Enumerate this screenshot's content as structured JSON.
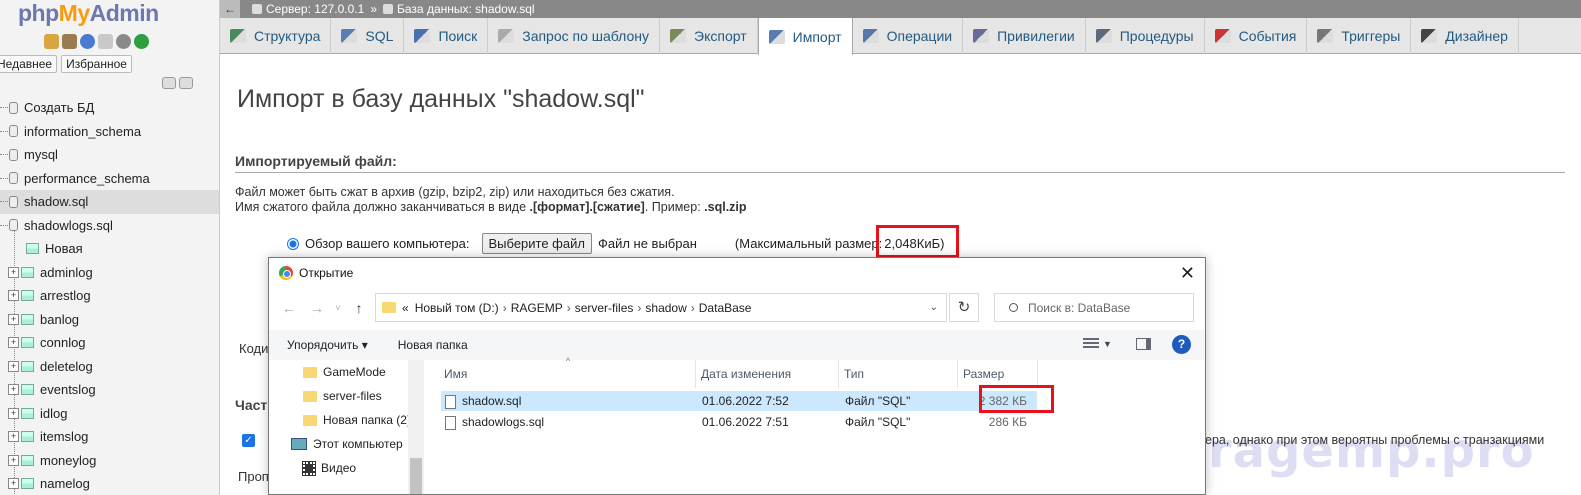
{
  "nav": {
    "logo_php": "php",
    "logo_my": "My",
    "logo_admin": "Admin",
    "recent_tab": "Недавнее",
    "favorites_tab": "Избранное",
    "tree": [
      {
        "label": "Создать БД",
        "kind": "root"
      },
      {
        "label": "information_schema",
        "kind": "db"
      },
      {
        "label": "mysql",
        "kind": "db"
      },
      {
        "label": "performance_schema",
        "kind": "db"
      },
      {
        "label": "shadow.sql",
        "kind": "db",
        "active": true
      },
      {
        "label": "shadowlogs.sql",
        "kind": "db"
      },
      {
        "label": "Новая",
        "kind": "new"
      },
      {
        "label": "adminlog",
        "kind": "table"
      },
      {
        "label": "arrestlog",
        "kind": "table"
      },
      {
        "label": "banlog",
        "kind": "table"
      },
      {
        "label": "connlog",
        "kind": "table"
      },
      {
        "label": "deletelog",
        "kind": "table"
      },
      {
        "label": "eventslog",
        "kind": "table"
      },
      {
        "label": "idlog",
        "kind": "table"
      },
      {
        "label": "itemslog",
        "kind": "table"
      },
      {
        "label": "moneylog",
        "kind": "table"
      },
      {
        "label": "namelog",
        "kind": "table"
      }
    ]
  },
  "breadcrumb": {
    "server": "Сервер: 127.0.0.1",
    "sep": "»",
    "database": "База данных: shadow.sql"
  },
  "tabs": [
    {
      "label": "Структура",
      "icon": "structure-icon"
    },
    {
      "label": "SQL",
      "icon": "sql-icon"
    },
    {
      "label": "Поиск",
      "icon": "search-icon"
    },
    {
      "label": "Запрос по шаблону",
      "icon": "query-icon"
    },
    {
      "label": "Экспорт",
      "icon": "export-icon"
    },
    {
      "label": "Импорт",
      "icon": "import-icon",
      "active": true
    },
    {
      "label": "Операции",
      "icon": "operations-icon"
    },
    {
      "label": "Привилегии",
      "icon": "privileges-icon"
    },
    {
      "label": "Процедуры",
      "icon": "routines-icon"
    },
    {
      "label": "События",
      "icon": "events-icon"
    },
    {
      "label": "Триггеры",
      "icon": "triggers-icon"
    },
    {
      "label": "Дизайнер",
      "icon": "designer-icon"
    }
  ],
  "main": {
    "title": "Импорт в базу данных \"shadow.sql\"",
    "section_title": "Импортируемый файл:",
    "desc_line1": "Файл может быть сжат в архив (gzip, bzip2, zip) или находиться без сжатия.",
    "desc_line2_pre": "Имя сжатого файла должно заканчиваться в виде ",
    "desc_line2_bold": ".[формат].[сжатие]",
    "desc_line2_mid": ". Пример: ",
    "desc_line2_example": ".sql.zip",
    "browse_label": "Обзор вашего компьютера:",
    "choose_file": "Выберите файл",
    "no_file": "Файл не выбран",
    "max_size_label": "(Максимальный размер:",
    "max_size_value": "2,048КиБ)",
    "cut_kodi": "Коди",
    "cut_chast": "Част",
    "cut_prop": "Проп",
    "right_text": "ера, однако при этом вероятны проблемы с транзакциями",
    "watermark": "ragemp.pro"
  },
  "dialog": {
    "title": "Открытие",
    "close": "✕",
    "address": [
      "Новый том (D:)",
      "RAGEMP",
      "server-files",
      "shadow",
      "DataBase"
    ],
    "address_prefix": "«",
    "search_placeholder": "Поиск в: DataBase",
    "organize": "Упорядочить ▾",
    "new_folder": "Новая папка",
    "left_items": [
      {
        "label": "GameMode",
        "kind": "folder"
      },
      {
        "label": "server-files",
        "kind": "folder"
      },
      {
        "label": "Новая папка (2)",
        "kind": "folder"
      },
      {
        "label": "Этот компьютер",
        "kind": "pc"
      },
      {
        "label": "Видео",
        "kind": "video"
      }
    ],
    "columns": {
      "name": "Имя",
      "date": "Дата изменения",
      "type": "Тип",
      "size": "Размер"
    },
    "files": [
      {
        "name": "shadow.sql",
        "date": "01.06.2022 7:52",
        "type": "Файл \"SQL\"",
        "size": "2 382 КБ",
        "selected": true
      },
      {
        "name": "shadowlogs.sql",
        "date": "01.06.2022 7:51",
        "type": "Файл \"SQL\"",
        "size": "286 КБ",
        "selected": false
      }
    ]
  }
}
